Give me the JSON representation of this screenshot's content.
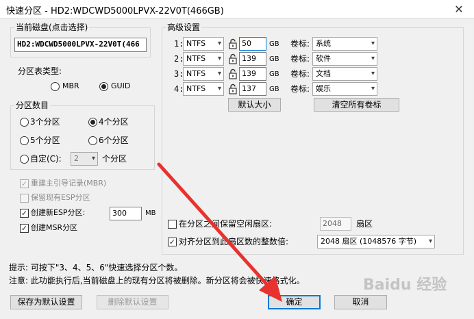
{
  "window": {
    "title": "快速分区 - HD2:WDCWD5000LPVX-22V0T(466GB)",
    "close_glyph": "✕"
  },
  "disk": {
    "label": "当前磁盘(点击选择)",
    "value": "HD2:WDCWD5000LPVX-22V0T(466"
  },
  "partition_table": {
    "label": "分区表类型:",
    "mbr": "MBR",
    "guid": "GUID",
    "selected": "GUID"
  },
  "partition_count": {
    "label": "分区数目",
    "options": [
      "3个分区",
      "4个分区",
      "5个分区",
      "6个分区"
    ],
    "selected": "4个分区",
    "custom_label": "自定(C):",
    "custom_value": "2",
    "custom_suffix": "个分区"
  },
  "options": {
    "rebuild_mbr": "重建主引导记录(MBR)",
    "keep_esp": "保留现有ESP分区",
    "create_esp": "创建新ESP分区:",
    "esp_size": "300",
    "esp_unit": "MB",
    "create_msr": "创建MSR分区"
  },
  "advanced": {
    "label": "高级设置",
    "unit": "GB",
    "volume_label_text": "卷标:",
    "rows": [
      {
        "index": "1:",
        "fs": "NTFS",
        "size": "50",
        "volume": "系统"
      },
      {
        "index": "2:",
        "fs": "NTFS",
        "size": "139",
        "volume": "软件"
      },
      {
        "index": "3:",
        "fs": "NTFS",
        "size": "139",
        "volume": "文档"
      },
      {
        "index": "4:",
        "fs": "NTFS",
        "size": "137",
        "volume": "娱乐"
      }
    ],
    "default_size_button": "默认大小",
    "clear_labels_button": "清空所有卷标",
    "reserve_label": "在分区之间保留空闲扇区:",
    "reserve_value": "2048",
    "reserve_unit": "扇区",
    "align_label": "对齐分区到此扇区数的整数倍:",
    "align_value": "2048 扇区 (1048576 字节)"
  },
  "hints": {
    "tip": "提示: 可按下\"3、4、5、6\"快速选择分区个数。",
    "warning": "注意: 此功能执行后,当前磁盘上的现有分区将被删除。新分区将会被快速格式化。"
  },
  "buttons": {
    "save_default": "保存为默认设置",
    "delete_default": "删除默认设置",
    "ok": "确定",
    "cancel": "取消"
  },
  "watermark": "Baidu 经验",
  "colors": {
    "accent": "#0078d7",
    "annotation_arrow": "#e8322f"
  }
}
